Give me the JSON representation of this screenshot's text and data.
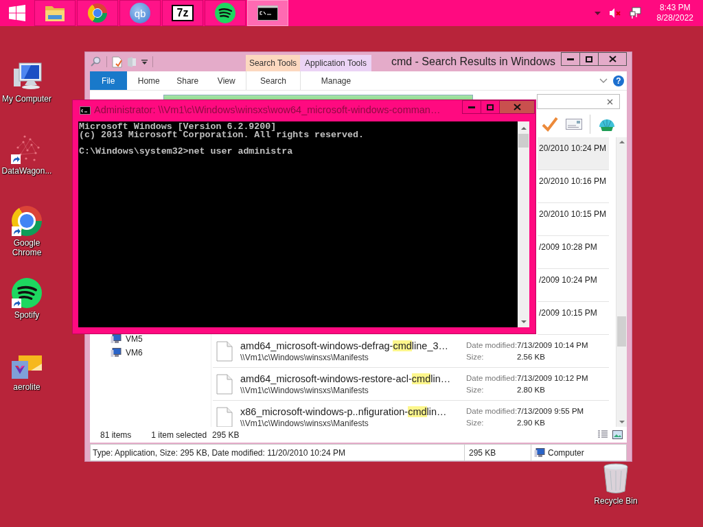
{
  "taskbar": {
    "apps": [
      {
        "kind": "folder",
        "selected": false
      },
      {
        "kind": "browser",
        "selected": false
      },
      {
        "kind": "torrent",
        "glyph": "qb",
        "selected": false
      },
      {
        "kind": "archive",
        "glyph": "7z",
        "selected": false
      },
      {
        "kind": "music",
        "selected": false
      },
      {
        "kind": "terminal",
        "selected": true
      }
    ],
    "clock": {
      "time": "8:43 PM",
      "date": "8/28/2022"
    }
  },
  "desktop_icons": [
    {
      "label": "My Computer",
      "kind": "computer",
      "shortcut": false
    },
    {
      "label": "DataWagon...",
      "kind": "scatter",
      "shortcut": true
    },
    {
      "label": "Google Chrome",
      "kind": "browser",
      "shortcut": true
    },
    {
      "label": "Spotify",
      "kind": "music",
      "shortcut": true
    },
    {
      "label": "aerolite",
      "kind": "image",
      "shortcut": false
    },
    {
      "label": "Recycle Bin",
      "kind": "trash",
      "shortcut": false
    }
  ],
  "explorer": {
    "title": "cmd - Search Results in Windows",
    "tool_tabs": [
      {
        "group": "Search Tools",
        "tab": "Search",
        "color": "#fcd8bf"
      },
      {
        "group": "Application Tools",
        "tab": "Manage",
        "color": "#ebd3f5"
      }
    ],
    "file_tab": "File",
    "tabs": [
      "Home",
      "Share",
      "View"
    ],
    "help": "?",
    "nav_items": [
      "VM5",
      "VM6"
    ],
    "results": [
      {
        "date_fragment": "20/2010 10:24 PM",
        "selected": true
      },
      {
        "date_fragment": "20/2010 10:16 PM",
        "selected": false
      },
      {
        "date_fragment": "20/2010 10:15 PM",
        "selected": false
      },
      {
        "date_fragment": "/2009 10:28 PM",
        "selected": false
      },
      {
        "date_fragment": "/2009 10:24 PM",
        "selected": false
      },
      {
        "date_fragment": "/2009 10:15 PM",
        "selected": false
      }
    ],
    "files": [
      {
        "name": [
          "amd64_microsoft-windows-defrag-",
          "cmd",
          "line_3…"
        ],
        "path": "\\\\Vm1\\c\\Windows\\winsxs\\Manifests",
        "date_label": "Date modified:",
        "date": "7/13/2009 10:14 PM",
        "size_label": "Size:",
        "size": "2.56 KB"
      },
      {
        "name": [
          "amd64_microsoft-windows-restore-acl-",
          "cmd",
          "lin…"
        ],
        "path": "\\\\Vm1\\c\\Windows\\winsxs\\Manifests",
        "date_label": "Date modified:",
        "date": "7/13/2009 10:12 PM",
        "size_label": "Size:",
        "size": "2.80 KB"
      },
      {
        "name": [
          "x86_microsoft-windows-p..nfiguration-",
          "cmd",
          "lin…"
        ],
        "path": "\\\\Vm1\\c\\Windows\\winsxs\\Manifests",
        "date_label": "Date modified:",
        "date": "7/13/2009 9:55 PM",
        "size_label": "Size:",
        "size": "2.90 KB"
      }
    ],
    "status": {
      "count": "81 items",
      "selection": "1 item selected",
      "selection_size": "295 KB"
    },
    "details_bar": {
      "info": "Type: Application, Size: 295 KB, Date modified: 11/20/2010 10:24 PM",
      "size": "295 KB",
      "location": "Computer"
    }
  },
  "cmd": {
    "title": "Administrator: \\\\Vm1\\c\\Windows\\winsxs\\wow64_microsoft-windows-comman…",
    "console": [
      [
        "Microsoft Windows [Version 6.2.9200]",
        "(c) 2013 Microsoft Corporation. All rights reserved."
      ],
      [
        "C:\\Windows\\system32>net user administra"
      ]
    ]
  }
}
